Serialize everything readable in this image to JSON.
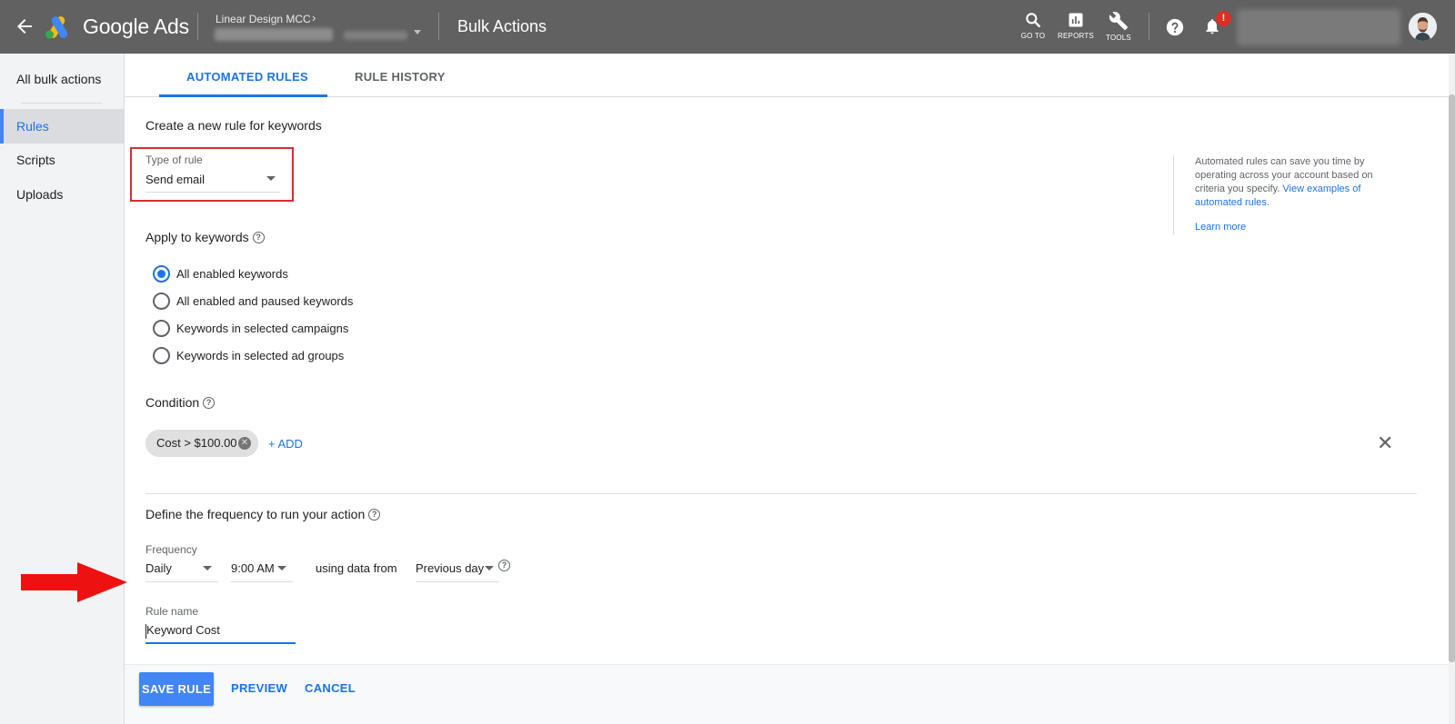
{
  "topbar": {
    "brand": "Google Ads",
    "account_name": "Linear Design MCC",
    "account_chevron": "›",
    "page_title": "Bulk Actions",
    "tools": [
      {
        "label": "GO TO",
        "icon": "search-icon"
      },
      {
        "label": "REPORTS",
        "icon": "reports-icon"
      },
      {
        "label": "TOOLS",
        "icon": "wrench-icon"
      }
    ],
    "notification_badge": "!"
  },
  "sidebar": {
    "all_label": "All bulk actions",
    "items": [
      {
        "label": "Rules",
        "active": true
      },
      {
        "label": "Scripts",
        "active": false
      },
      {
        "label": "Uploads",
        "active": false
      }
    ]
  },
  "tabs": [
    {
      "label": "AUTOMATED RULES",
      "active": true
    },
    {
      "label": "RULE HISTORY",
      "active": false
    }
  ],
  "form": {
    "heading": "Create a new rule for keywords",
    "type_of_rule": {
      "label": "Type of rule",
      "value": "Send email"
    },
    "apply_heading": "Apply to keywords",
    "apply_options": [
      {
        "label": "All enabled keywords",
        "checked": true
      },
      {
        "label": "All enabled and paused keywords",
        "checked": false
      },
      {
        "label": "Keywords in selected campaigns",
        "checked": false
      },
      {
        "label": "Keywords in selected ad groups",
        "checked": false
      }
    ],
    "condition_heading": "Condition",
    "condition_chip": "Cost > $100.00",
    "add_label": "+ ADD",
    "frequency_heading": "Define the frequency to run your action",
    "frequency": {
      "label": "Frequency",
      "value": "Daily"
    },
    "time": {
      "value": "9:00 AM"
    },
    "using_data_text": "using data from",
    "data_range": {
      "value": "Previous day"
    },
    "rule_name": {
      "label": "Rule name",
      "value": "Keyword Cost"
    }
  },
  "side_note": {
    "text": "Automated rules can save you time by operating across your account based on criteria you specify.",
    "link": "View examples of automated rules.",
    "learn_more": "Learn more"
  },
  "footer": {
    "save": "SAVE RULE",
    "preview": "PREVIEW",
    "cancel": "CANCEL"
  },
  "colors": {
    "topbar": "#616161",
    "accent": "#1a73e8",
    "highlight_red": "#d32f2f",
    "annotation_arrow": "#ee1111"
  }
}
